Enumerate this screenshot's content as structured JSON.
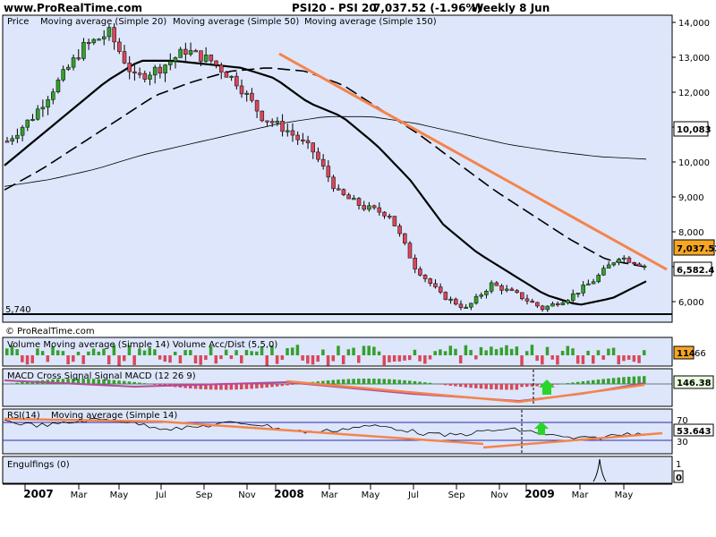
{
  "header": {
    "site": "www.ProRealTime.com",
    "instrument": "PSI20 - PSI 20",
    "last": "7,037.52 (-1.96%)",
    "period": "Weekly  8 Jun"
  },
  "price_panel": {
    "legend": [
      "Price",
      "Moving average (Simple 20)",
      "Moving average (Simple 50)",
      "Moving average (Simple 150)"
    ],
    "watermark": "© ProRealTime.com",
    "low_label": "5,740",
    "price_tag": "7,037.52",
    "ma20_tag": "6,582.4",
    "ma150_tag": "10,083",
    "y_ticks": [
      "14,000",
      "13,000",
      "12,000",
      "11,000",
      "10,000",
      "9,000",
      "8,000",
      "7,000",
      "6,000"
    ]
  },
  "volume_panel": {
    "label": "Volume Moving average (Simple 14) Volume Acc/Dist (5,5,0)",
    "tag_value": "114",
    "tag_value2": "66"
  },
  "macd_panel": {
    "label": "MACD Cross Signal Signal MACD (12 26 9)",
    "tag_value": "146.38"
  },
  "rsi_panel": {
    "label": "RSI(14)",
    "label2": "Moving average (Simple 14)",
    "tag_value": "53.643",
    "level_hi": "70",
    "level_lo": "30"
  },
  "engulf_panel": {
    "label": "Engulfings (0)",
    "tick_hi": "1",
    "tick_lo": "0"
  },
  "x_axis": {
    "labels": [
      "2007",
      "Mar",
      "May",
      "Jul",
      "Sep",
      "Nov",
      "2008",
      "Mar",
      "May",
      "Jul",
      "Sep",
      "Nov",
      "2009",
      "Mar",
      "May"
    ],
    "years": [
      "2007",
      "2008",
      "2009"
    ]
  },
  "colors": {
    "panel_bg": "#dde6fb",
    "up": "#33a02c",
    "down": "#d9475a",
    "trendline": "#f4844a",
    "ma20": "#000000",
    "tag_price": "#f5a623"
  },
  "chart_data": {
    "type": "candlestick",
    "title": "PSI20 - PSI 20",
    "x": [
      "2007",
      "Mar",
      "May",
      "Jul",
      "Sep",
      "Nov",
      "2008",
      "Mar",
      "May",
      "Jul",
      "Sep",
      "Nov",
      "2009",
      "Mar",
      "May"
    ],
    "ylim": [
      5600,
      14300
    ],
    "price_path": [
      10600,
      11300,
      12300,
      13300,
      13700,
      12400,
      12700,
      13200,
      12900,
      12300,
      11300,
      10900,
      10300,
      9100,
      8700,
      8500,
      7000,
      6200,
      5800,
      6500,
      6200,
      5800,
      6100,
      6600,
      7300,
      7037.52
    ],
    "ma20_path": [
      9900,
      10700,
      11500,
      12300,
      12900,
      12900,
      12800,
      12700,
      12400,
      11700,
      11300,
      10500,
      9500,
      8200,
      7400,
      6800,
      6200,
      5900,
      6100,
      6582.4
    ],
    "ma150_value": 10083,
    "trendline": [
      [
        13100,
        "Jan 2008"
      ],
      [
        7037.52,
        "Jun 2009"
      ]
    ]
  }
}
